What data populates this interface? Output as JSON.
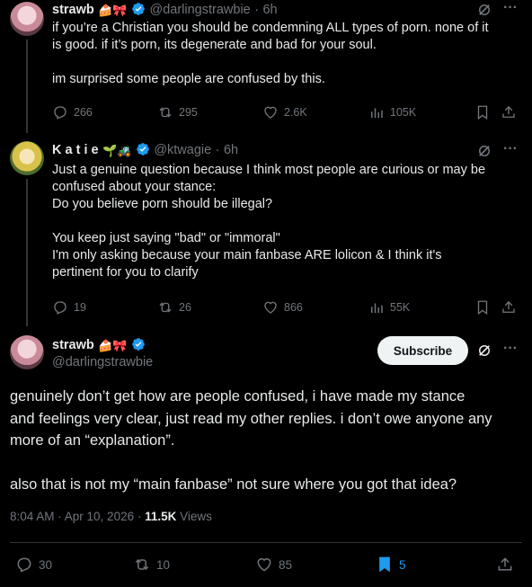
{
  "tweet1": {
    "name": "strawb",
    "handle": "@darlingstrawbie",
    "time": "6h",
    "line1": "if you’re a Christian you should be condemning ALL types of porn. none of it",
    "line2": "is good. if it’s porn, its degenerate and bad for your soul.",
    "line3": "im surprised some people are confused by this.",
    "replies": "266",
    "reposts": "295",
    "likes": "2.6K",
    "views": "105K"
  },
  "tweet2": {
    "name": "K a t i e",
    "handle": "@ktwagie",
    "time": "6h",
    "lines": [
      "Just a genuine question because I think most people are curious or may be",
      "confused about your stance:",
      "Do you believe porn should be illegal?",
      "",
      "You keep just saying \"bad\" or \"immoral\"",
      "I'm only asking because your main fanbase ARE lolicon & I think it's",
      "pertinent for you to clarify"
    ],
    "replies": "19",
    "reposts": "26",
    "likes": "866",
    "views": "55K"
  },
  "main": {
    "name": "strawb",
    "handle": "@darlingstrawbie",
    "subscribe_label": "Subscribe",
    "line1": "genuinely don’t get how are people confused, i have made my stance",
    "line2": "and feelings very clear, just read my other replies. i don’t owe anyone any",
    "line3": "more of an “explanation”.",
    "line4": "also that is not my “main fanbase” not sure where you got that idea?",
    "timestamp": "8:04 AM · Apr 10, 2026 · ",
    "views_count": "11.5K",
    "views_label": " Views",
    "replies": "30",
    "reposts": "10",
    "likes": "85",
    "bookmarks": "5"
  },
  "separator": "·",
  "colors": {
    "background": "#000000",
    "text": "#e7e9ea",
    "secondary": "#71767b",
    "verified": "#1d9bf0",
    "bookmark_active": "#1d9bf0",
    "divider": "#2f3336"
  }
}
